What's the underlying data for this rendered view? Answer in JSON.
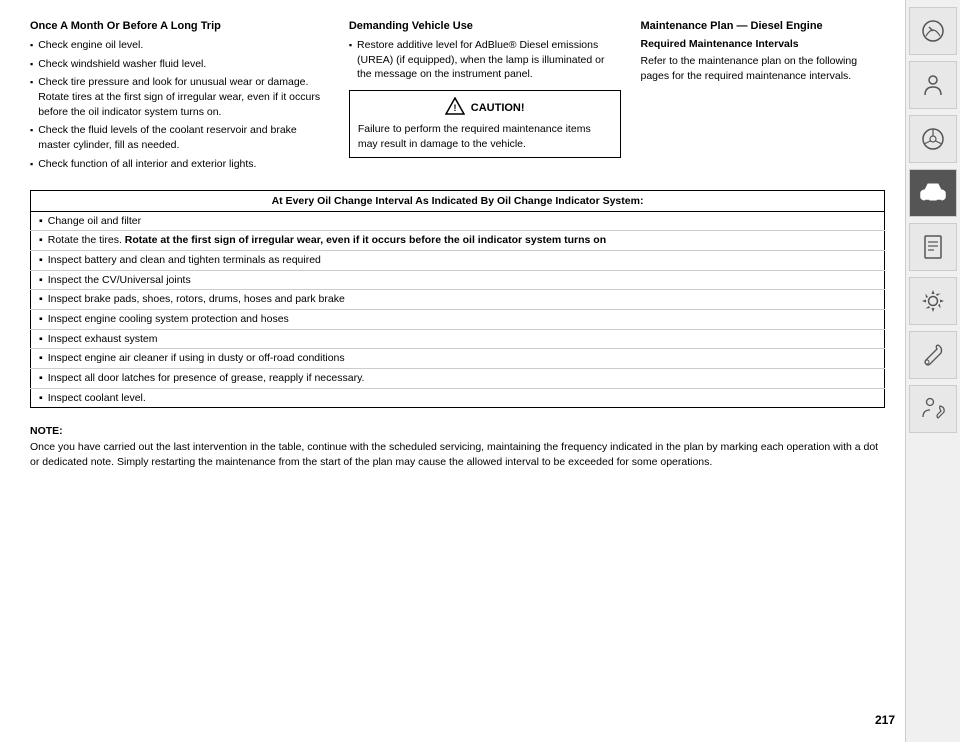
{
  "page": {
    "number": "217"
  },
  "sidebar": {
    "icons": [
      {
        "name": "gauge-icon",
        "active": false,
        "symbol": "⊙"
      },
      {
        "name": "person-icon",
        "active": false,
        "symbol": "👤"
      },
      {
        "name": "steering-icon",
        "active": false,
        "symbol": "🔧"
      },
      {
        "name": "car-settings-icon",
        "active": true,
        "symbol": "🚗"
      },
      {
        "name": "document-icon",
        "active": false,
        "symbol": "📋"
      },
      {
        "name": "gear-service-icon",
        "active": false,
        "symbol": "⚙"
      },
      {
        "name": "tools-icon",
        "active": false,
        "symbol": "🔧"
      },
      {
        "name": "person2-icon",
        "active": false,
        "symbol": "👤"
      }
    ]
  },
  "col_left": {
    "title": "Once A Month Or Before A Long Trip",
    "items": [
      "Check engine oil level.",
      "Check windshield washer fluid level.",
      "Check tire pressure and look for unusual wear or damage. Rotate tires at the first sign of irregular wear, even if it occurs before the oil indicator system turns on.",
      "Check the fluid levels of the coolant reservoir and brake master cylinder, fill as needed.",
      "Check function of all interior and exterior lights."
    ]
  },
  "col_middle": {
    "title": "Demanding Vehicle Use",
    "items": [
      "Restore additive level for AdBlue® Diesel emissions (UREA) (if equipped), when the lamp is illuminated or the message on the instrument panel."
    ],
    "caution": {
      "header": "CAUTION!",
      "text": "Failure to perform the required maintenance items may result in damage to the vehicle."
    }
  },
  "col_right": {
    "title": "Maintenance Plan — Diesel Engine",
    "subsection": "Required Maintenance Intervals",
    "text": "Refer to the maintenance plan on the following pages for the required maintenance intervals."
  },
  "oil_change_section": {
    "header": "At Every Oil Change Interval As Indicated By Oil Change Indicator System:",
    "items": [
      {
        "text": "Change oil and filter",
        "bold_part": ""
      },
      {
        "text": "Rotate the tires. Rotate at the first sign of irregular wear, even if it occurs before the oil indicator system turns on",
        "bold_part": "Rotate at the first sign of irregular wear, even if it occurs before the oil indicator system turns on"
      },
      {
        "text": "Inspect battery and clean and tighten terminals as required",
        "bold_part": ""
      },
      {
        "text": "Inspect the CV/Universal joints",
        "bold_part": ""
      },
      {
        "text": "Inspect brake pads, shoes, rotors, drums, hoses and park brake",
        "bold_part": ""
      },
      {
        "text": "Inspect engine cooling system protection and hoses",
        "bold_part": ""
      },
      {
        "text": "Inspect exhaust system",
        "bold_part": ""
      },
      {
        "text": "Inspect engine air cleaner if using in dusty or off-road conditions",
        "bold_part": ""
      },
      {
        "text": "Inspect all door latches for presence of grease, reapply if necessary.",
        "bold_part": ""
      },
      {
        "text": "Inspect coolant level.",
        "bold_part": ""
      }
    ]
  },
  "note_section": {
    "label": "NOTE:",
    "text": "Once you have carried out the last intervention in the table, continue with the scheduled servicing, maintaining the frequency indicated in the plan by marking each operation with a dot or dedicated note. Simply restarting the maintenance from the start of the plan may cause the allowed interval to be exceeded for some operations."
  }
}
